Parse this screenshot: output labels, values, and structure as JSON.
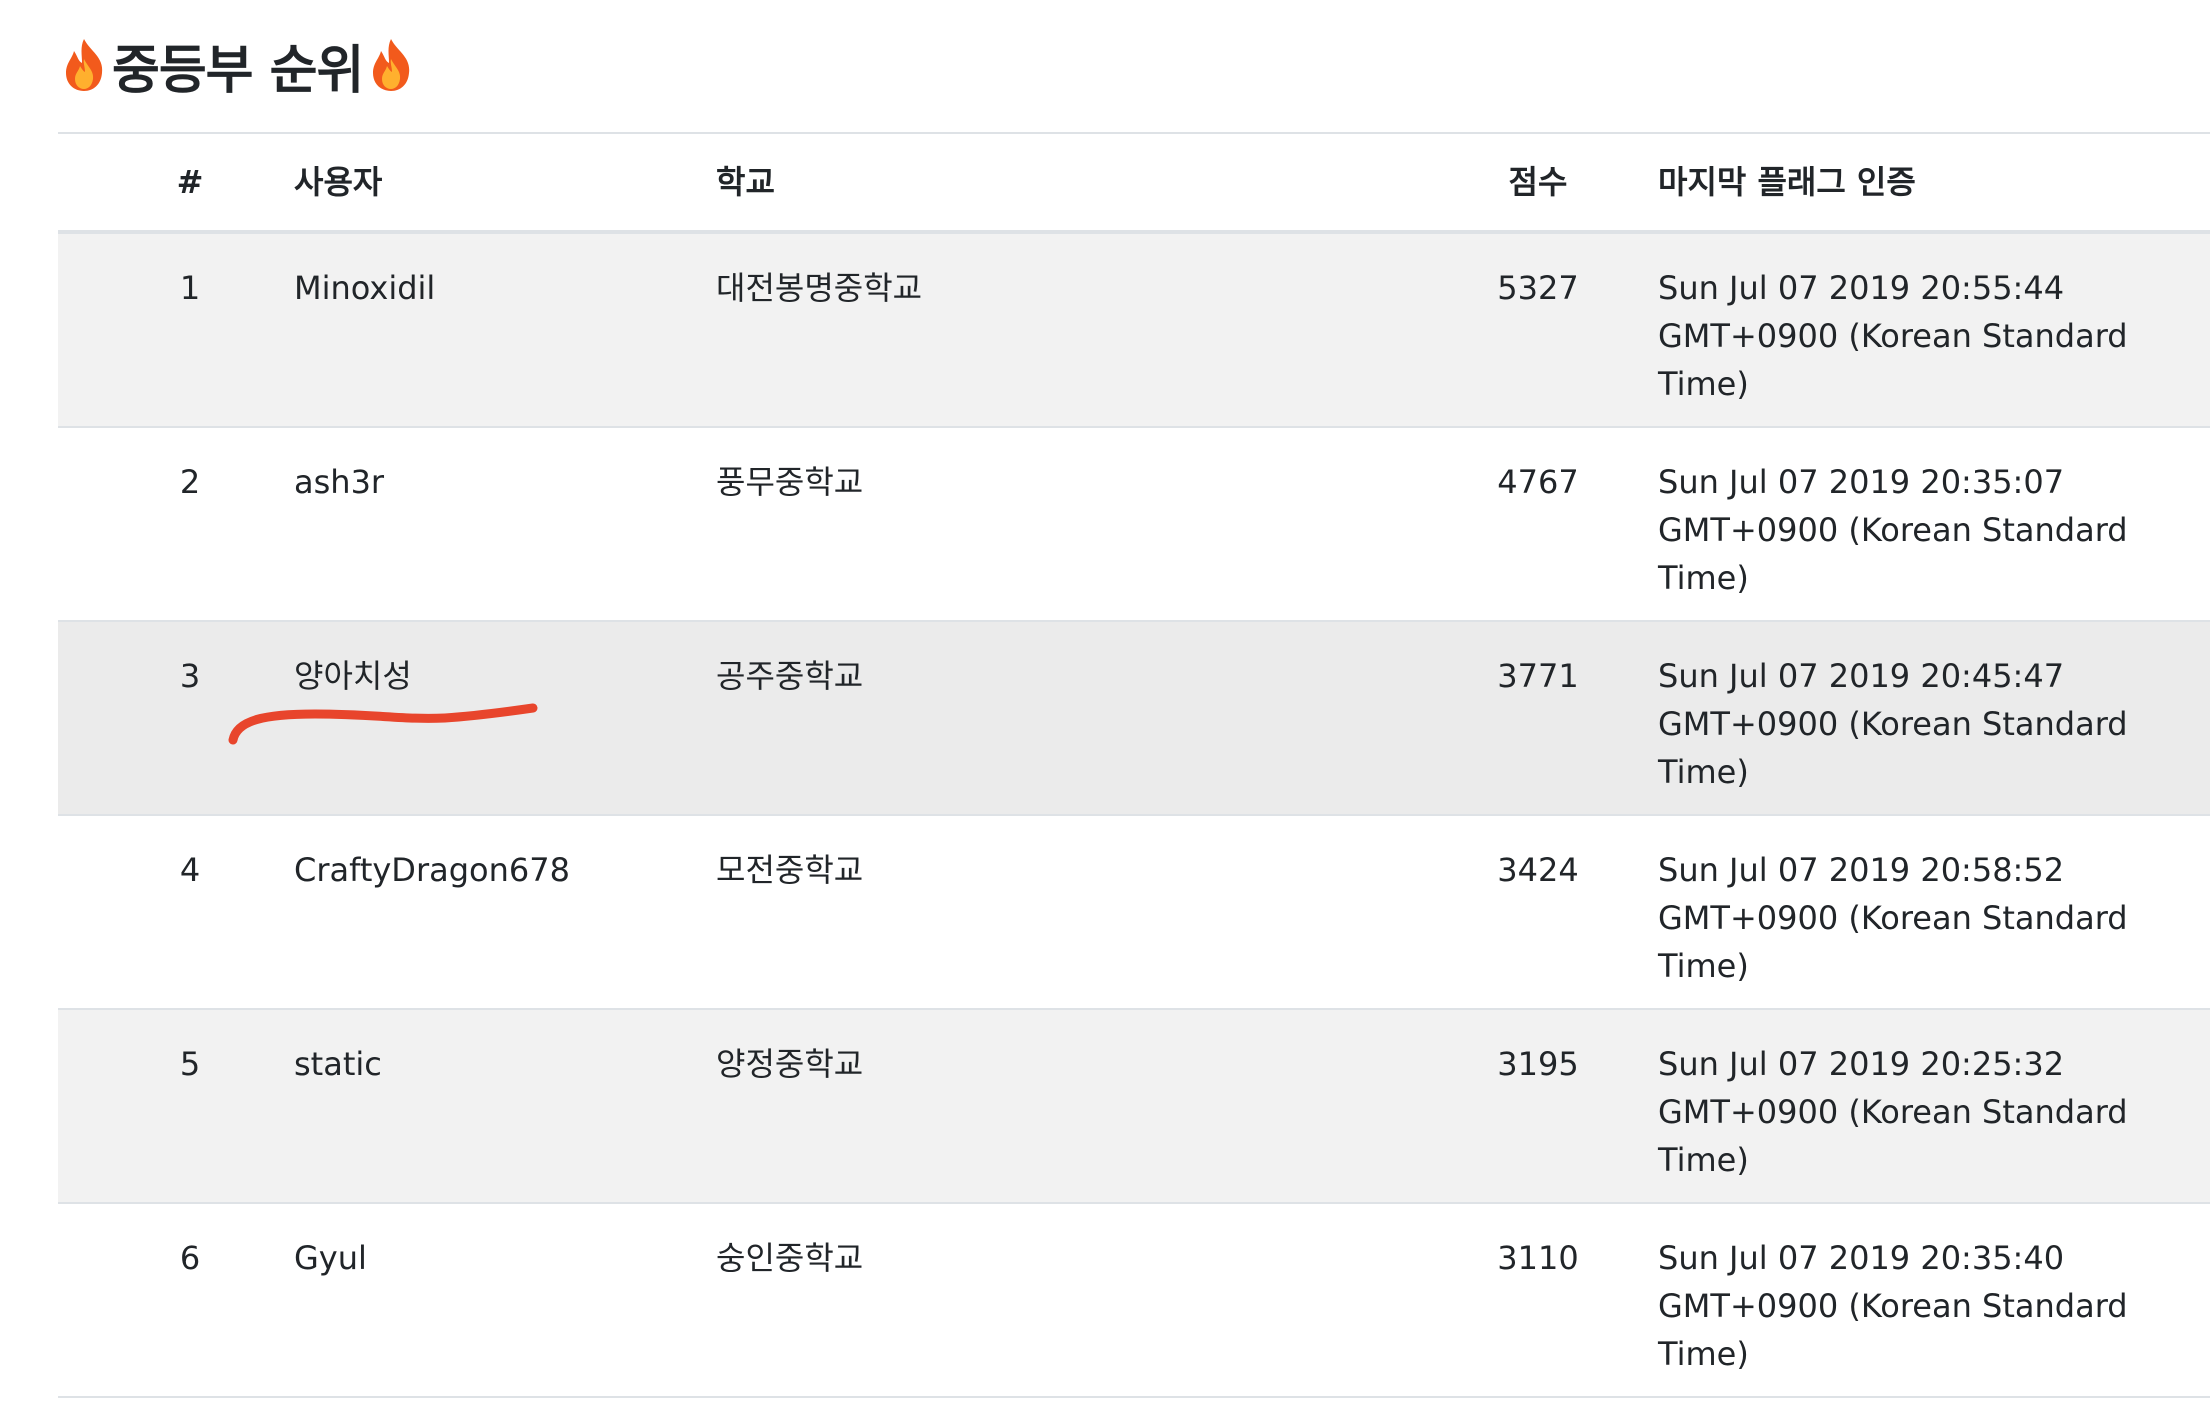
{
  "title": {
    "text": "중등부 순위",
    "icon": "fire-icon"
  },
  "table": {
    "headers": {
      "rank": "#",
      "user": "사용자",
      "school": "학교",
      "score": "점수",
      "last_auth": "마지막 플래그 인증"
    },
    "rows": [
      {
        "rank": "1",
        "user": "Minoxidil",
        "school": "대전봉명중학교",
        "score": "5327",
        "time": "Sun Jul 07 2019 20:55:44 GMT+0900 (Korean Standard Time)"
      },
      {
        "rank": "2",
        "user": "ash3r",
        "school": "풍무중학교",
        "score": "4767",
        "time": "Sun Jul 07 2019 20:35:07 GMT+0900 (Korean Standard Time)"
      },
      {
        "rank": "3",
        "user": "양아치성",
        "school": "공주중학교",
        "score": "3771",
        "time": "Sun Jul 07 2019 20:45:47 GMT+0900 (Korean Standard Time)"
      },
      {
        "rank": "4",
        "user": "CraftyDragon678",
        "school": "모전중학교",
        "score": "3424",
        "time": "Sun Jul 07 2019 20:58:52 GMT+0900 (Korean Standard Time)"
      },
      {
        "rank": "5",
        "user": "static",
        "school": "양정중학교",
        "score": "3195",
        "time": "Sun Jul 07 2019 20:25:32 GMT+0900 (Korean Standard Time)"
      },
      {
        "rank": "6",
        "user": "Gyul",
        "school": "숭인중학교",
        "score": "3110",
        "time": "Sun Jul 07 2019 20:35:40 GMT+0900 (Korean Standard Time)"
      }
    ]
  },
  "colors": {
    "stripe": "#f2f2f2",
    "hover_row": "#ebebeb",
    "border": "#dee2e6",
    "annotation": "#e8452c",
    "text": "#212529"
  }
}
